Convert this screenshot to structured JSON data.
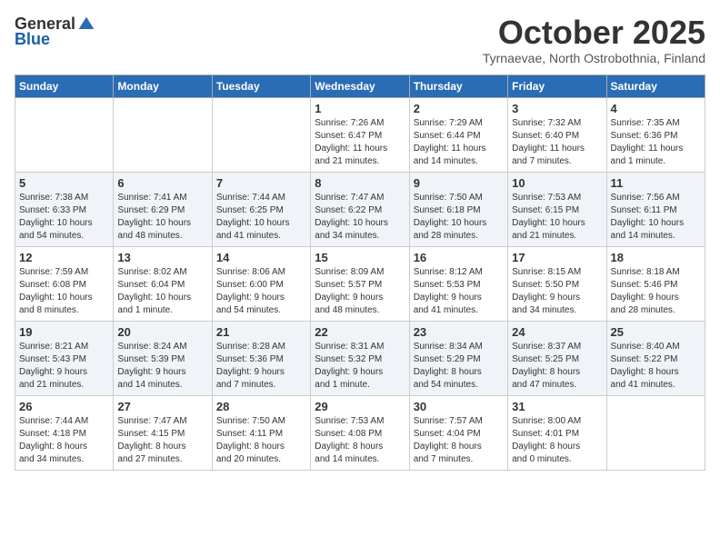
{
  "header": {
    "logo_general": "General",
    "logo_blue": "Blue",
    "month_title": "October 2025",
    "subtitle": "Tyrnaevae, North Ostrobothnia, Finland"
  },
  "days_of_week": [
    "Sunday",
    "Monday",
    "Tuesday",
    "Wednesday",
    "Thursday",
    "Friday",
    "Saturday"
  ],
  "weeks": [
    [
      {
        "day": "",
        "content": ""
      },
      {
        "day": "",
        "content": ""
      },
      {
        "day": "",
        "content": ""
      },
      {
        "day": "1",
        "content": "Sunrise: 7:26 AM\nSunset: 6:47 PM\nDaylight: 11 hours\nand 21 minutes."
      },
      {
        "day": "2",
        "content": "Sunrise: 7:29 AM\nSunset: 6:44 PM\nDaylight: 11 hours\nand 14 minutes."
      },
      {
        "day": "3",
        "content": "Sunrise: 7:32 AM\nSunset: 6:40 PM\nDaylight: 11 hours\nand 7 minutes."
      },
      {
        "day": "4",
        "content": "Sunrise: 7:35 AM\nSunset: 6:36 PM\nDaylight: 11 hours\nand 1 minute."
      }
    ],
    [
      {
        "day": "5",
        "content": "Sunrise: 7:38 AM\nSunset: 6:33 PM\nDaylight: 10 hours\nand 54 minutes."
      },
      {
        "day": "6",
        "content": "Sunrise: 7:41 AM\nSunset: 6:29 PM\nDaylight: 10 hours\nand 48 minutes."
      },
      {
        "day": "7",
        "content": "Sunrise: 7:44 AM\nSunset: 6:25 PM\nDaylight: 10 hours\nand 41 minutes."
      },
      {
        "day": "8",
        "content": "Sunrise: 7:47 AM\nSunset: 6:22 PM\nDaylight: 10 hours\nand 34 minutes."
      },
      {
        "day": "9",
        "content": "Sunrise: 7:50 AM\nSunset: 6:18 PM\nDaylight: 10 hours\nand 28 minutes."
      },
      {
        "day": "10",
        "content": "Sunrise: 7:53 AM\nSunset: 6:15 PM\nDaylight: 10 hours\nand 21 minutes."
      },
      {
        "day": "11",
        "content": "Sunrise: 7:56 AM\nSunset: 6:11 PM\nDaylight: 10 hours\nand 14 minutes."
      }
    ],
    [
      {
        "day": "12",
        "content": "Sunrise: 7:59 AM\nSunset: 6:08 PM\nDaylight: 10 hours\nand 8 minutes."
      },
      {
        "day": "13",
        "content": "Sunrise: 8:02 AM\nSunset: 6:04 PM\nDaylight: 10 hours\nand 1 minute."
      },
      {
        "day": "14",
        "content": "Sunrise: 8:06 AM\nSunset: 6:00 PM\nDaylight: 9 hours\nand 54 minutes."
      },
      {
        "day": "15",
        "content": "Sunrise: 8:09 AM\nSunset: 5:57 PM\nDaylight: 9 hours\nand 48 minutes."
      },
      {
        "day": "16",
        "content": "Sunrise: 8:12 AM\nSunset: 5:53 PM\nDaylight: 9 hours\nand 41 minutes."
      },
      {
        "day": "17",
        "content": "Sunrise: 8:15 AM\nSunset: 5:50 PM\nDaylight: 9 hours\nand 34 minutes."
      },
      {
        "day": "18",
        "content": "Sunrise: 8:18 AM\nSunset: 5:46 PM\nDaylight: 9 hours\nand 28 minutes."
      }
    ],
    [
      {
        "day": "19",
        "content": "Sunrise: 8:21 AM\nSunset: 5:43 PM\nDaylight: 9 hours\nand 21 minutes."
      },
      {
        "day": "20",
        "content": "Sunrise: 8:24 AM\nSunset: 5:39 PM\nDaylight: 9 hours\nand 14 minutes."
      },
      {
        "day": "21",
        "content": "Sunrise: 8:28 AM\nSunset: 5:36 PM\nDaylight: 9 hours\nand 7 minutes."
      },
      {
        "day": "22",
        "content": "Sunrise: 8:31 AM\nSunset: 5:32 PM\nDaylight: 9 hours\nand 1 minute."
      },
      {
        "day": "23",
        "content": "Sunrise: 8:34 AM\nSunset: 5:29 PM\nDaylight: 8 hours\nand 54 minutes."
      },
      {
        "day": "24",
        "content": "Sunrise: 8:37 AM\nSunset: 5:25 PM\nDaylight: 8 hours\nand 47 minutes."
      },
      {
        "day": "25",
        "content": "Sunrise: 8:40 AM\nSunset: 5:22 PM\nDaylight: 8 hours\nand 41 minutes."
      }
    ],
    [
      {
        "day": "26",
        "content": "Sunrise: 7:44 AM\nSunset: 4:18 PM\nDaylight: 8 hours\nand 34 minutes."
      },
      {
        "day": "27",
        "content": "Sunrise: 7:47 AM\nSunset: 4:15 PM\nDaylight: 8 hours\nand 27 minutes."
      },
      {
        "day": "28",
        "content": "Sunrise: 7:50 AM\nSunset: 4:11 PM\nDaylight: 8 hours\nand 20 minutes."
      },
      {
        "day": "29",
        "content": "Sunrise: 7:53 AM\nSunset: 4:08 PM\nDaylight: 8 hours\nand 14 minutes."
      },
      {
        "day": "30",
        "content": "Sunrise: 7:57 AM\nSunset: 4:04 PM\nDaylight: 8 hours\nand 7 minutes."
      },
      {
        "day": "31",
        "content": "Sunrise: 8:00 AM\nSunset: 4:01 PM\nDaylight: 8 hours\nand 0 minutes."
      },
      {
        "day": "",
        "content": ""
      }
    ]
  ]
}
